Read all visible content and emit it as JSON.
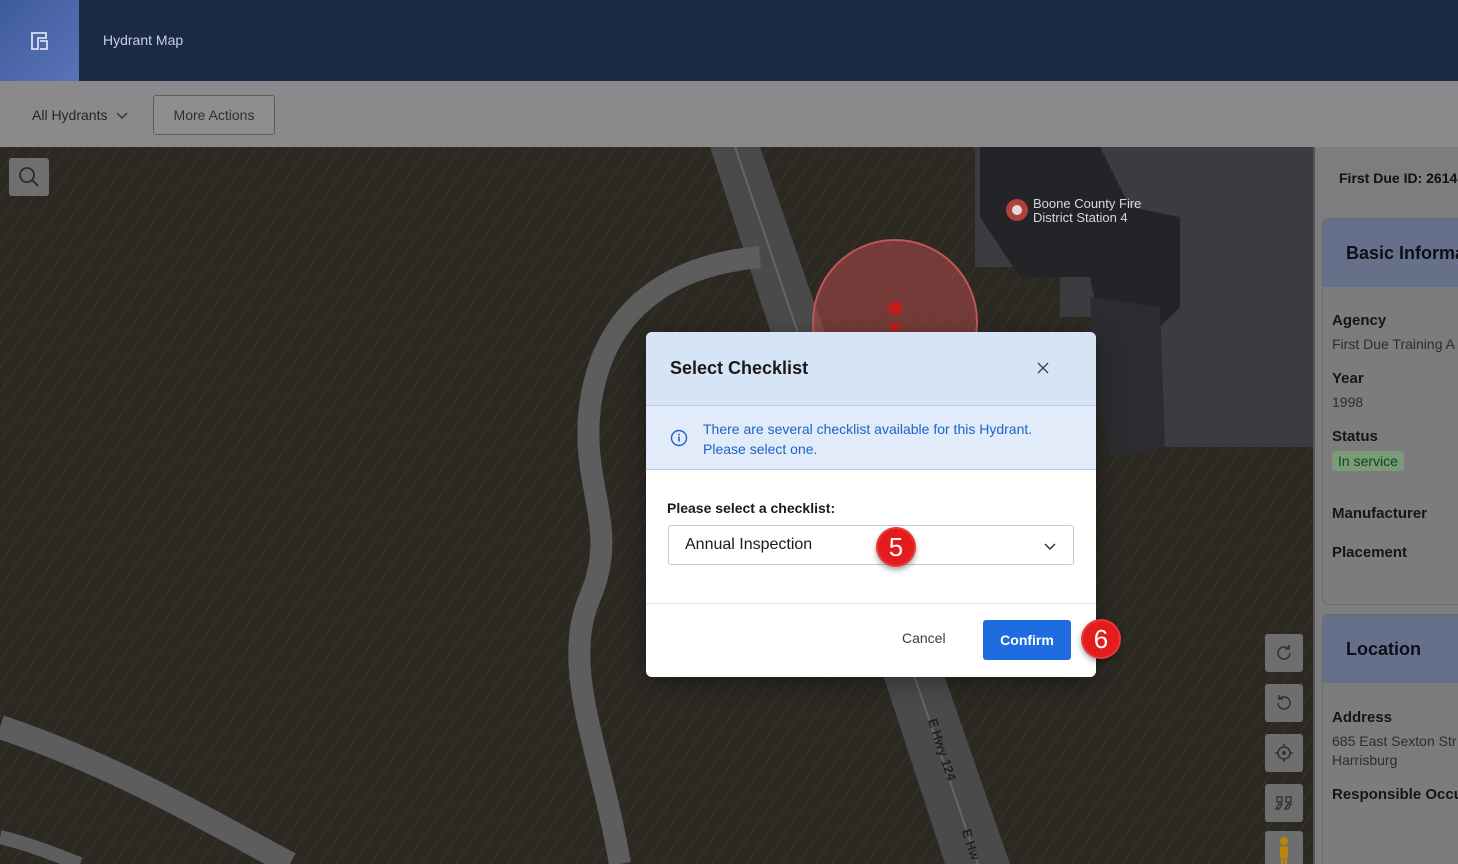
{
  "app": {
    "title": "Hydrant Map"
  },
  "toolbar": {
    "filter_label": "All Hydrants",
    "more_actions_label": "More Actions"
  },
  "map": {
    "poi_label_line1": "Boone County Fire",
    "poi_label_line2": "District Station 4",
    "road_label_1": "E Hwy 124",
    "road_label_2": "E Hw"
  },
  "panel": {
    "first_due_id": "First Due ID: 2614",
    "basic_info": {
      "title": "Basic Informa",
      "agency_label": "Agency",
      "agency_value": "First Due Training A",
      "year_label": "Year",
      "year_value": "1998",
      "status_label": "Status",
      "status_value": "In service",
      "manufacturer_label": "Manufacturer",
      "placement_label": "Placement"
    },
    "location": {
      "title": "Location",
      "address_label": "Address",
      "address_line1": "685 East Sexton Str",
      "address_line2": "Harrisburg",
      "responsible_label": "Responsible Occu"
    }
  },
  "modal": {
    "title": "Select Checklist",
    "info_line1": "There are several checklist available for this Hydrant.",
    "info_line2": "Please select one.",
    "select_label": "Please select a checklist:",
    "selected_value": "Annual Inspection",
    "cancel_label": "Cancel",
    "confirm_label": "Confirm"
  },
  "annotations": {
    "step_5": "5",
    "step_6": "6"
  },
  "colors": {
    "primary": "#1f6be0",
    "badge": "#e41c1c",
    "info_text": "#1d63c9"
  }
}
